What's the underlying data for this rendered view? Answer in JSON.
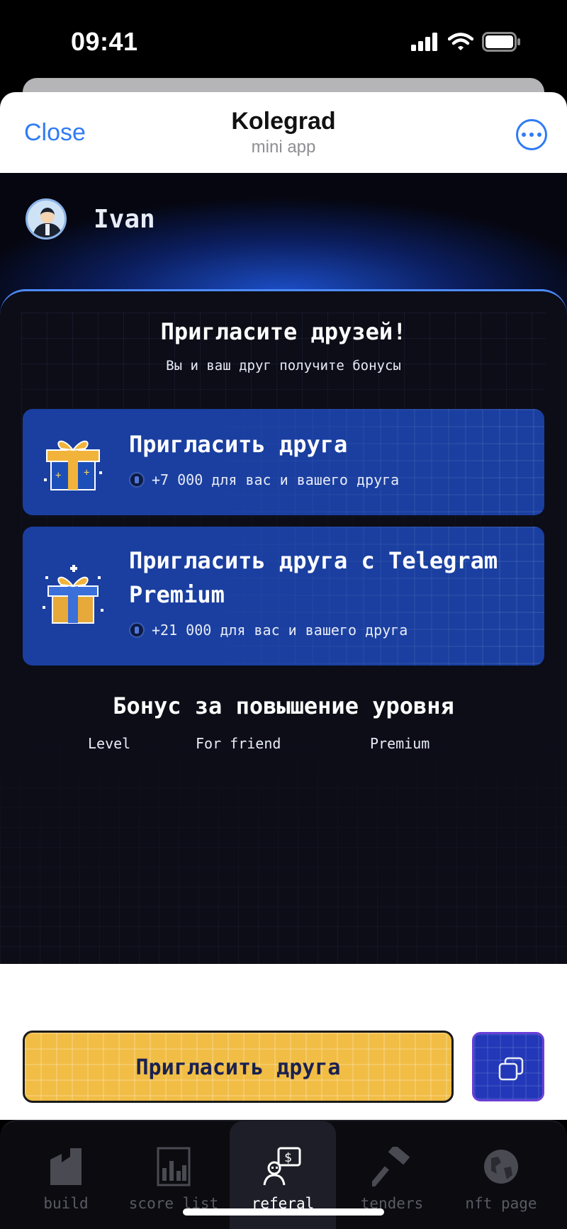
{
  "status_bar": {
    "time": "09:41"
  },
  "header": {
    "close_label": "Close",
    "title": "Kolegrad",
    "subtitle": "mini app"
  },
  "user": {
    "name": "Ivan"
  },
  "invite": {
    "title": "Пригласите друзей!",
    "subtitle": "Вы и ваш друг получите бонусы",
    "cards": [
      {
        "title": "Пригласить друга",
        "reward": "+7 000 для вас и вашего друга",
        "icon": "gift-icon"
      },
      {
        "title": "Пригласить друга с Telegram Premium",
        "reward": "+21 000 для вас и вашего друга",
        "icon": "premium-gift-icon"
      }
    ]
  },
  "bonus": {
    "title": "Бонус за повышение уровня",
    "columns": [
      "Level",
      "For friend",
      "Premium"
    ]
  },
  "actions": {
    "invite_button": "Пригласить друга",
    "copy_button_icon": "copy-icon"
  },
  "tabs": [
    {
      "label": "build",
      "icon": "building-icon",
      "active": false
    },
    {
      "label": "score list",
      "icon": "chart-icon",
      "active": false
    },
    {
      "label": "referal",
      "icon": "referral-icon",
      "active": true
    },
    {
      "label": "tenders",
      "icon": "hammer-icon",
      "active": false
    },
    {
      "label": "nft page",
      "icon": "globe-icon",
      "active": false
    }
  ],
  "colors": {
    "accent_blue": "#2f7bf5",
    "card_blue": "#1a3fa0",
    "button_yellow": "#f1bd45",
    "panel_dark": "#0c0d17"
  }
}
